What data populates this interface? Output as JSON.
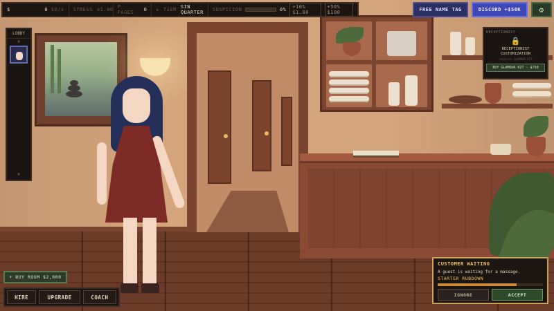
{
  "topbar": {
    "currency_symbol": "$",
    "money": "0",
    "money_rate": "$0/s",
    "stress_label": "STRESS",
    "stress_mult": "x1.00",
    "pages_icon": "P",
    "pages_label": "PAGES",
    "pages_count": "0",
    "tier_icon": "★",
    "tier_label": "TIER",
    "tier_name": "SIN QUARTER",
    "suspicion_label": "SUSPICION",
    "suspicion_percent": "0%",
    "suspicion_value": 0,
    "chip_1": "+10% $1.00",
    "chip_2": "+50% $100"
  },
  "top_buttons": {
    "free_name_tag": "FREE NAME TAG",
    "discord": "DISCORD +$50K",
    "settings_icon": "gear-icon",
    "settings_glyph": "⚙"
  },
  "lobby": {
    "title": "LOBBY",
    "up_arrow": "▲",
    "down_arrow": "▼"
  },
  "receptionist": {
    "title": "RECEPTIONIST",
    "lock_glyph": "🔒",
    "subtitle_line1": "RECEPTIONIST",
    "subtitle_line2": "CUSTOMIZATION",
    "note": "requires GLAMOUR KIT",
    "button": "BUY GLAMOUR KIT - $750"
  },
  "actions": {
    "buy_room": "+ BUY ROOM $2,000",
    "hire": "HIRE",
    "upgrade": "UPGRADE",
    "coach": "COACH"
  },
  "customer": {
    "title": "CUSTOMER WAITING",
    "message": "A guest is waiting for a massage.",
    "service": "STARTER RUBDOWN",
    "patience": 0.75,
    "ignore": "IGNORE",
    "accept": "ACCEPT"
  },
  "colors": {
    "accent_gold": "#f0c35a",
    "accept_green": "#2d4a2a",
    "discord_blue": "#3f48b8"
  }
}
